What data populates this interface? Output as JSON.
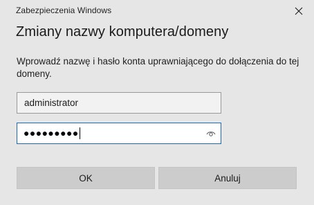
{
  "window": {
    "title": "Zabezpieczenia Windows"
  },
  "dialog": {
    "heading": "Zmiany nazwy komputera/domeny",
    "description": "Wprowadź nazwę i hasło konta uprawniającego do dołączenia do tej domeny."
  },
  "form": {
    "username_value": "administrator",
    "password_masked": "●●●●●●●●●"
  },
  "buttons": {
    "ok_label": "OK",
    "cancel_label": "Anuluj"
  },
  "icons": {
    "close": "close-icon",
    "reveal": "eye-icon"
  },
  "colors": {
    "background": "#e6e6e6",
    "focus_border": "#1a68b8",
    "button_bg": "#cccccc"
  }
}
